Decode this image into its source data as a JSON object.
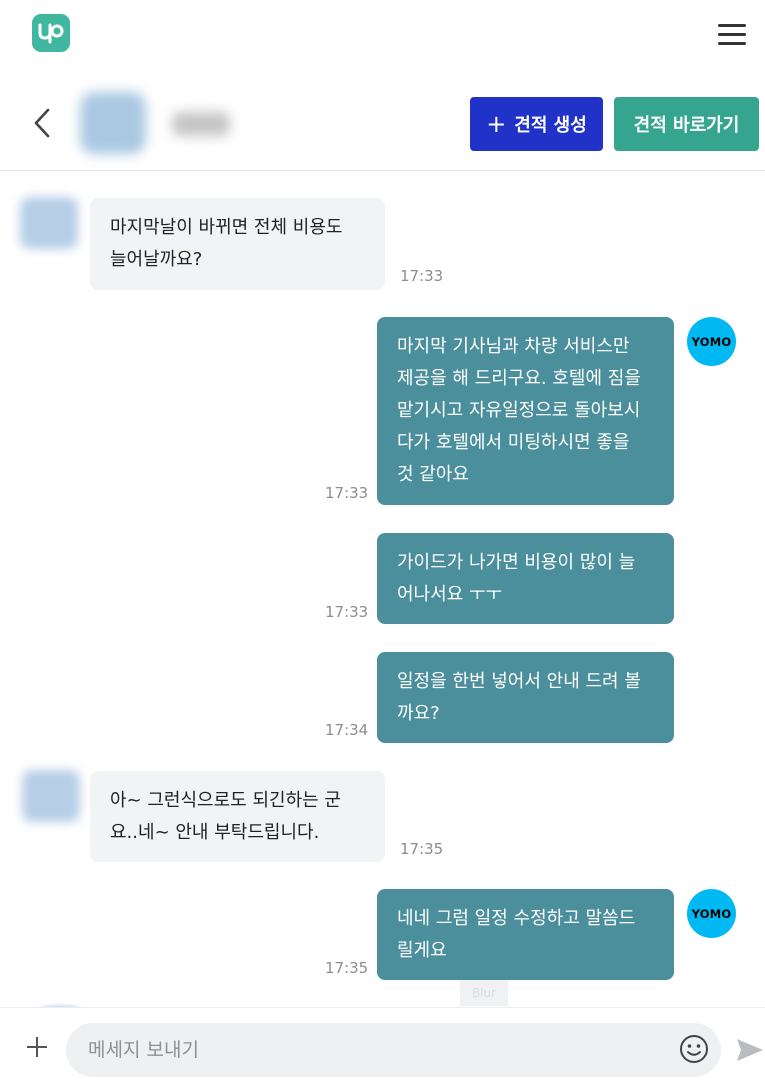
{
  "app": {
    "logo_icon": "brand-logo-icon",
    "menu_icon": "hamburger-menu-icon",
    "brand_color": "#3fb7a1"
  },
  "header": {
    "back_icon": "chevron-left-icon",
    "create_quote_label": "견적 생성",
    "create_quote_icon": "plus-icon",
    "go_quote_label": "견적 바로가기"
  },
  "messages": [
    {
      "side": "in",
      "lines": [
        "마지막날이 바뀌면 전체 비용도",
        "늘어날까요?"
      ],
      "time": "17:33"
    },
    {
      "side": "out",
      "sender": "YOMO",
      "lines": [
        "마지막 기사님과 차량 서비스만",
        "제공을 해 드리구요. 호텔에 짐을",
        "맡기시고 자유일정으로 돌아보시",
        "다가 호텔에서 미팅하시면 좋을",
        "것 같아요"
      ],
      "time": "17:33"
    },
    {
      "side": "out",
      "lines": [
        "가이드가 나가면 비용이 많이 늘",
        "어나서요 ㅜㅜ"
      ],
      "time": "17:33"
    },
    {
      "side": "out",
      "lines": [
        "일정을 한번 넣어서 안내 드려 볼",
        "까요?"
      ],
      "time": "17:34"
    },
    {
      "side": "in",
      "lines": [
        "아~ 그런식으로도 되긴하는 군",
        "요..네~ 안내 부탁드립니다."
      ],
      "time": "17:35"
    },
    {
      "side": "out",
      "sender": "YOMO",
      "lines": [
        "네네 그럼 일정 수정하고 말씀드",
        "릴게요"
      ],
      "time": "17:35"
    }
  ],
  "watermark": "Blur",
  "input": {
    "placeholder": "메세지 보내기",
    "attach_icon": "plus-icon",
    "emoji_icon": "smiley-icon",
    "send_icon": "send-arrow-icon"
  },
  "colors": {
    "outgoing_bubble": "#4b8f9c",
    "incoming_bubble": "#f2f3f4",
    "create_button": "#2032c8",
    "go_button": "#35a58f",
    "yomo_avatar": "#00b9f2"
  }
}
